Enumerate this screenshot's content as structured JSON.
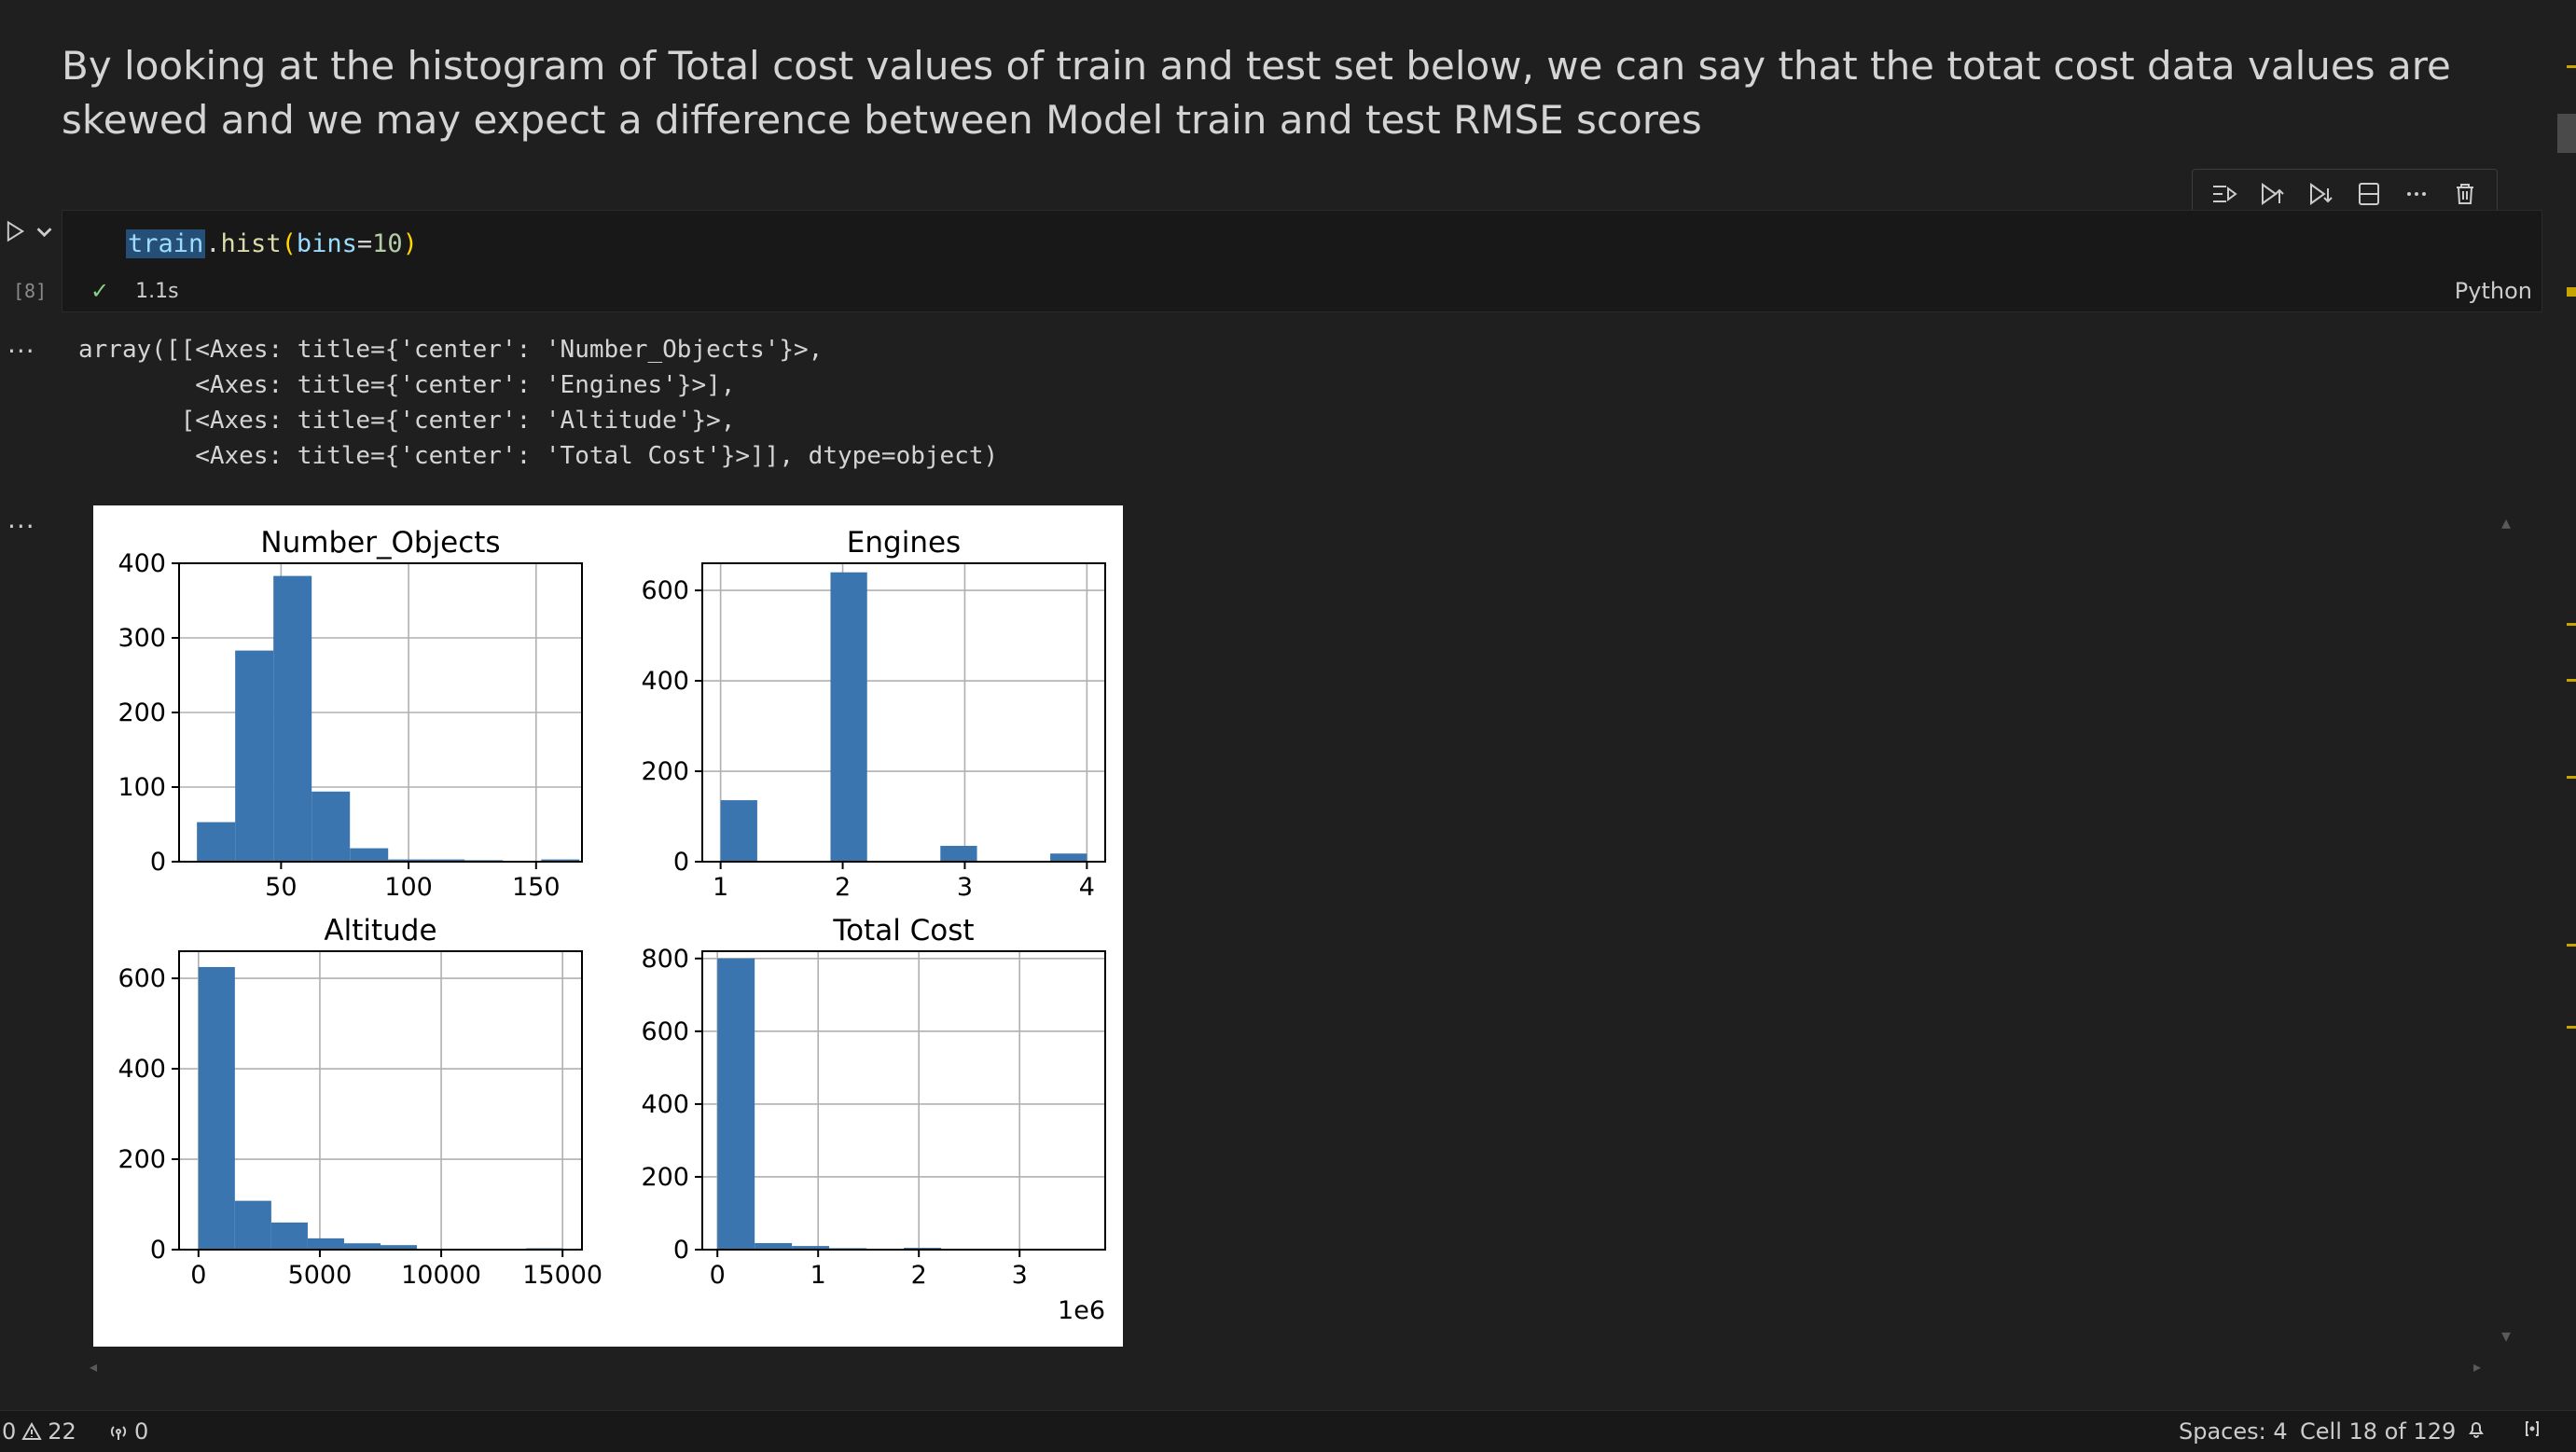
{
  "markdown": {
    "text": "By looking at the histogram of Total cost values of train and test set below, we can say that the totat cost data values are skewed and we may expect a difference between Model train and test RMSE scores"
  },
  "cell": {
    "exec_count": "[8]",
    "code": {
      "var": "train",
      "dot": ".",
      "fn": "hist",
      "open": "(",
      "arg": "bins",
      "eq": "=",
      "num": "10",
      "close": ")"
    },
    "exec_time": "1.1s",
    "language": "Python"
  },
  "output": {
    "dots": "...",
    "text": "array([[<Axes: title={'center': 'Number_Objects'}>,\n        <Axes: title={'center': 'Engines'}>],\n       [<Axes: title={'center': 'Altitude'}>,\n        <Axes: title={'center': 'Total Cost'}>]], dtype=object)"
  },
  "status_bar": {
    "errors": "0",
    "warnings": "22",
    "ports": "0",
    "spaces": "Spaces: 4",
    "cell_pos": "Cell 18 of 129"
  },
  "colors": {
    "bar": "#3a75b0",
    "accent_check": "#89d185"
  },
  "chart_data": [
    {
      "type": "bar",
      "title": "Number_Objects",
      "xlim": [
        10,
        168
      ],
      "ylim": [
        0,
        400
      ],
      "xticks": [
        50,
        100,
        150
      ],
      "yticks": [
        0,
        100,
        200,
        300,
        400
      ],
      "bins": [
        [
          17,
          32,
          53
        ],
        [
          32,
          47,
          283
        ],
        [
          47,
          62,
          383
        ],
        [
          62,
          77,
          94
        ],
        [
          77,
          92,
          18
        ],
        [
          92,
          107,
          3
        ],
        [
          107,
          122,
          3
        ],
        [
          122,
          137,
          2
        ],
        [
          137,
          152,
          0
        ],
        [
          152,
          167,
          3
        ]
      ]
    },
    {
      "type": "bar",
      "title": "Engines",
      "xlim": [
        0.85,
        4.15
      ],
      "ylim": [
        0,
        660
      ],
      "xticks": [
        1,
        2,
        3,
        4
      ],
      "yticks": [
        0,
        200,
        400,
        600
      ],
      "bins": [
        [
          1.0,
          1.3,
          136
        ],
        [
          1.3,
          1.6,
          0
        ],
        [
          1.6,
          1.9,
          0
        ],
        [
          1.9,
          2.2,
          640
        ],
        [
          2.2,
          2.5,
          0
        ],
        [
          2.5,
          2.8,
          0
        ],
        [
          2.8,
          3.1,
          35
        ],
        [
          3.1,
          3.4,
          0
        ],
        [
          3.4,
          3.7,
          0
        ],
        [
          3.7,
          4.0,
          18
        ]
      ]
    },
    {
      "type": "bar",
      "title": "Altitude",
      "xlim": [
        -800,
        15800
      ],
      "ylim": [
        0,
        660
      ],
      "xticks": [
        0,
        5000,
        10000,
        15000
      ],
      "yticks": [
        0,
        200,
        400,
        600
      ],
      "bins": [
        [
          0,
          1500,
          625
        ],
        [
          1500,
          3000,
          108
        ],
        [
          3000,
          4500,
          60
        ],
        [
          4500,
          6000,
          25
        ],
        [
          6000,
          7500,
          14
        ],
        [
          7500,
          9000,
          10
        ],
        [
          9000,
          10500,
          2
        ],
        [
          10500,
          12000,
          0
        ],
        [
          12000,
          13500,
          0
        ],
        [
          13500,
          15000,
          3
        ]
      ]
    },
    {
      "type": "bar",
      "title": "Total Cost",
      "xlim": [
        -150000,
        3850000
      ],
      "ylim": [
        0,
        820
      ],
      "xticks": [
        0,
        1,
        2,
        3
      ],
      "yticks": [
        0,
        200,
        400,
        600,
        800
      ],
      "offset_label": "1e6",
      "bins": [
        [
          0,
          370000,
          800
        ],
        [
          370000,
          740000,
          18
        ],
        [
          740000,
          1110000,
          10
        ],
        [
          1110000,
          1480000,
          4
        ],
        [
          1480000,
          1850000,
          0
        ],
        [
          1850000,
          2220000,
          5
        ],
        [
          2220000,
          2590000,
          0
        ],
        [
          2590000,
          2960000,
          0
        ],
        [
          2960000,
          3330000,
          0
        ],
        [
          3330000,
          3700000,
          2
        ]
      ]
    }
  ]
}
